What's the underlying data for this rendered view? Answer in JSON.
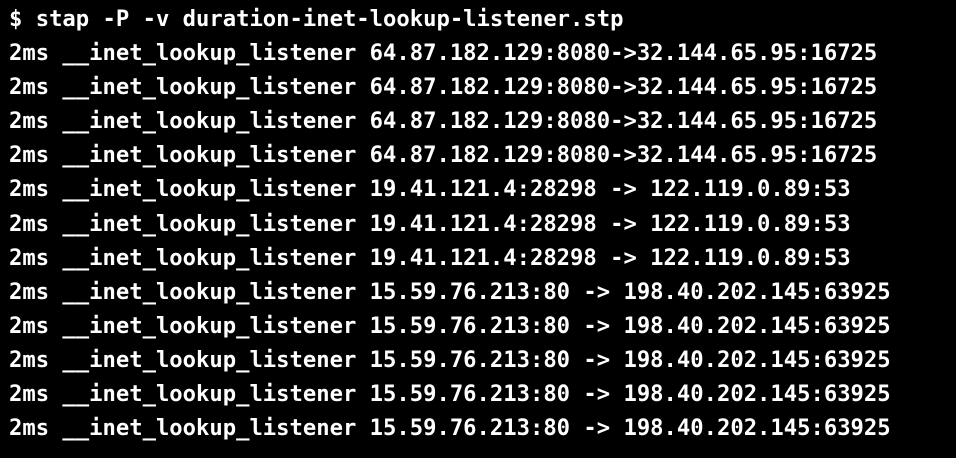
{
  "terminal": {
    "background": "#000000",
    "foreground": "#ffffff",
    "command_line": "$ stap -P -v duration-inet-lookup-listener.stp",
    "output_lines": [
      "2ms __inet_lookup_listener 64.87.182.129:8080->32.144.65.95:16725",
      "2ms __inet_lookup_listener 64.87.182.129:8080->32.144.65.95:16725",
      "2ms __inet_lookup_listener 64.87.182.129:8080->32.144.65.95:16725",
      "2ms __inet_lookup_listener 64.87.182.129:8080->32.144.65.95:16725",
      "2ms __inet_lookup_listener 19.41.121.4:28298 -> 122.119.0.89:53",
      "2ms __inet_lookup_listener 19.41.121.4:28298 -> 122.119.0.89:53",
      "2ms __inet_lookup_listener 19.41.121.4:28298 -> 122.119.0.89:53",
      "2ms __inet_lookup_listener 15.59.76.213:80 -> 198.40.202.145:63925",
      "2ms __inet_lookup_listener 15.59.76.213:80 -> 198.40.202.145:63925",
      "2ms __inet_lookup_listener 15.59.76.213:80 -> 198.40.202.145:63925",
      "2ms __inet_lookup_listener 15.59.76.213:80 -> 198.40.202.145:63925",
      "2ms __inet_lookup_listener 15.59.76.213:80 -> 198.40.202.145:63925"
    ]
  }
}
